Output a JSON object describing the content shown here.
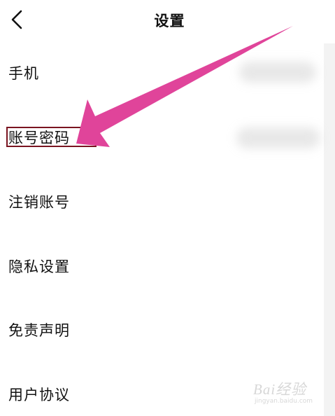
{
  "header": {
    "title": "设置",
    "back_icon": "chevron-left-icon"
  },
  "settings": {
    "items": [
      {
        "label": "手机"
      },
      {
        "label": "账号密码"
      },
      {
        "label": "注销账号"
      },
      {
        "label": "隐私设置"
      },
      {
        "label": "免责声明"
      },
      {
        "label": "用户协议"
      }
    ]
  },
  "annotation": {
    "arrow_color": "#e0449a",
    "box_color": "#7a1420"
  },
  "watermark": {
    "brand": "Bai经验",
    "url": "jingyan.baidu.com"
  }
}
